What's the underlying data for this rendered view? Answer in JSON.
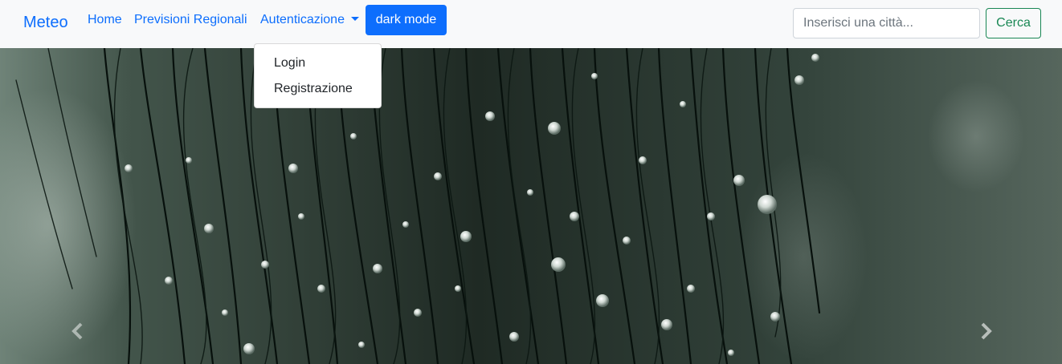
{
  "navbar": {
    "brand": "Meteo",
    "links": [
      "Home",
      "Previsioni Regionali",
      "Autenticazione"
    ],
    "dark_mode_label": "dark mode",
    "search": {
      "placeholder": "Inserisci una città...",
      "value": "",
      "button_label": "Cerca"
    }
  },
  "dropdown": {
    "items": [
      "Login",
      "Registrazione"
    ]
  },
  "carousel": {
    "controls": [
      "chevron-left-icon",
      "chevron-right-icon"
    ]
  },
  "colors": {
    "primary": "#0d6efd",
    "success": "#198754",
    "navbar_bg": "#f8f9fa"
  }
}
